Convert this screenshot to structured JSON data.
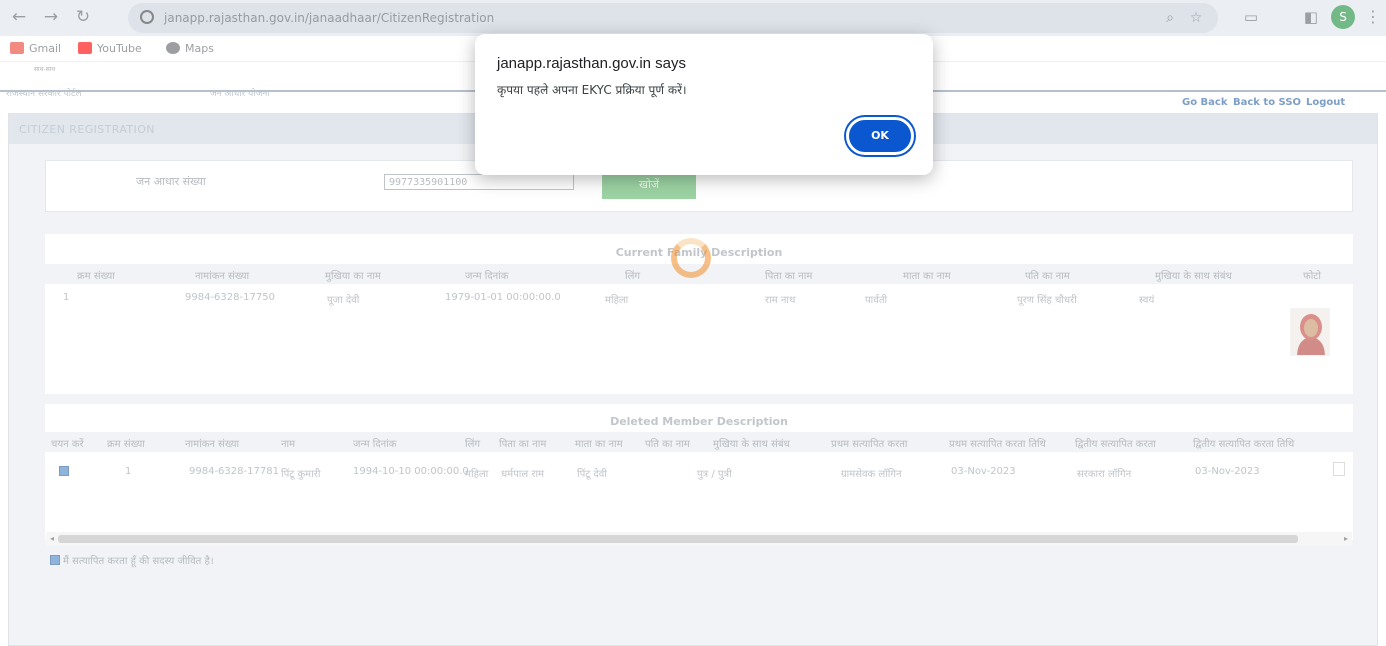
{
  "browser": {
    "url": "janapp.rajasthan.gov.in/janaadhaar/CitizenRegistration",
    "bookmarks": [
      {
        "label": "Gmail",
        "color": "#ea4335"
      },
      {
        "label": "YouTube",
        "color": "#ff0000"
      },
      {
        "label": "Maps",
        "color": "#34a853"
      }
    ],
    "profile_initial": "S"
  },
  "header": {
    "logo_text": "साथ-साथ",
    "left_text": "राजस्थान सरकार पोर्टल",
    "mid_text": "जन आधार योजना",
    "links": [
      "Go Back",
      "Back to SSO",
      "Logout"
    ]
  },
  "panel": {
    "title": "CITIZEN REGISTRATION",
    "jan_aadhaar_label": "जन आधार संख्या",
    "jan_aadhaar_value": "9977335901100",
    "search_label": "खोजें"
  },
  "current_family": {
    "title": "Current Family Description",
    "headers": [
      "क्रम संख्या",
      "नामांकन संख्या",
      "मुखिया का नाम",
      "जन्म दिनांक",
      "लिंग",
      "पिता का नाम",
      "माता का नाम",
      "पति का नाम",
      "मुखिया के साथ संबंध",
      "फोटो"
    ],
    "rows": [
      [
        "1",
        "9984-6328-17750",
        "पूजा देवी",
        "1979-01-01 00:00:00.0",
        "महिला",
        "राम नाथ",
        "पार्वती",
        "पूरण सिंह चौधरी",
        "स्वयं"
      ]
    ]
  },
  "deleted_members": {
    "title": "Deleted Member Description",
    "headers": [
      "चयन करें",
      "क्रम संख्या",
      "नामांकन संख्या",
      "नाम",
      "जन्म दिनांक",
      "लिंग",
      "पिता का नाम",
      "माता का नाम",
      "पति का नाम",
      "मुखिया के साथ संबंध",
      "प्रथम सत्यापित करता",
      "प्रथम सत्यापित करता तिथि",
      "द्वितीय सत्यापित करता",
      "द्वितीय सत्यापित करता तिथि"
    ],
    "rows": [
      [
        "1",
        "9984-6328-17781",
        "पिंटू कुमारी",
        "1994-10-10 00:00:00.0",
        "महिला",
        "धर्मपाल राम",
        "पिंटू देवी",
        "",
        "पुत्र / पुत्री",
        "ग्रामसेवक लॉगिन",
        "03-Nov-2023",
        "सरकारा लॉगिन",
        "03-Nov-2023"
      ]
    ]
  },
  "declaration": "मैं सत्यापित करता हूँ की सदस्य जीवित है।",
  "dialog": {
    "title": "janapp.rajasthan.gov.in says",
    "message": "कृपया पहले अपना EKYC प्रक्रिया पूर्ण करें।",
    "ok_label": "OK"
  }
}
